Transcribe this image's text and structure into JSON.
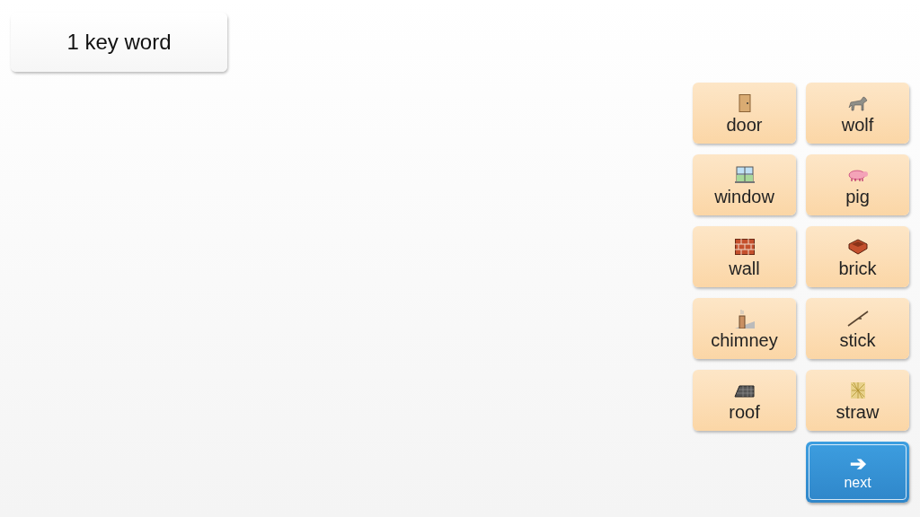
{
  "header": {
    "label": "1 key word"
  },
  "words": [
    {
      "label": "door"
    },
    {
      "label": "wolf"
    },
    {
      "label": "window"
    },
    {
      "label": "pig"
    },
    {
      "label": "wall"
    },
    {
      "label": "brick"
    },
    {
      "label": "chimney"
    },
    {
      "label": "stick"
    },
    {
      "label": "roof"
    },
    {
      "label": "straw"
    }
  ],
  "next_button": {
    "label": "next",
    "icon": "➔"
  }
}
